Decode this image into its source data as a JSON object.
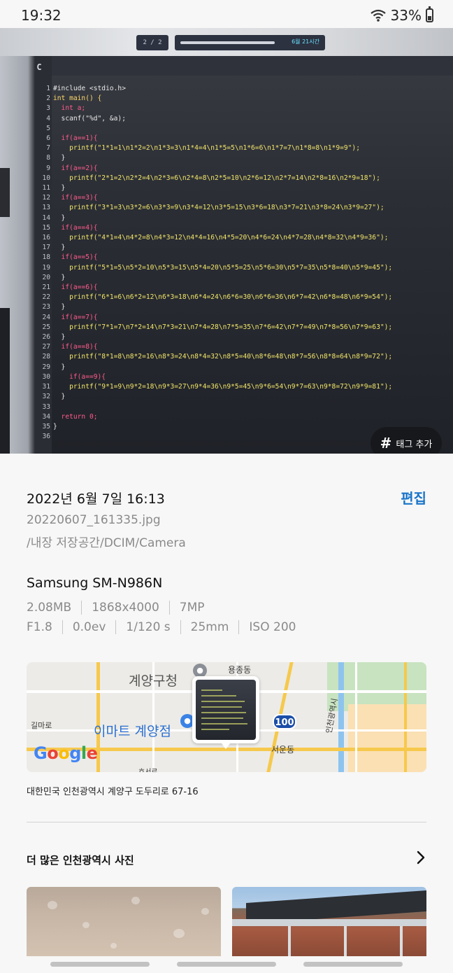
{
  "status_bar": {
    "time": "19:32",
    "battery": "33%"
  },
  "photo": {
    "counter": "2 / 2",
    "progress_label": "6월 21시간",
    "editor_tab": "C",
    "code_lines": [
      [
        "#include <stdio.h>",
        "plain"
      ],
      [
        "int main() {",
        "fn"
      ],
      [
        "  int a;",
        "kw"
      ],
      [
        "  scanf(\"%d\", &a);",
        "plain"
      ],
      [
        "",
        "plain"
      ],
      [
        "  if(a==1){",
        "kw"
      ],
      [
        "    printf(\"1*1=1\\n1*2=2\\n1*3=3\\n1*4=4\\n1*5=5\\n1*6=6\\n1*7=7\\n1*8=8\\n1*9=9\");",
        "str"
      ],
      [
        "  }",
        "plain"
      ],
      [
        "  if(a==2){",
        "kw"
      ],
      [
        "    printf(\"2*1=2\\n2*2=4\\n2*3=6\\n2*4=8\\n2*5=10\\n2*6=12\\n2*7=14\\n2*8=16\\n2*9=18\");",
        "str"
      ],
      [
        "  }",
        "plain"
      ],
      [
        "  if(a==3){",
        "kw"
      ],
      [
        "    printf(\"3*1=3\\n3*2=6\\n3*3=9\\n3*4=12\\n3*5=15\\n3*6=18\\n3*7=21\\n3*8=24\\n3*9=27\");",
        "str"
      ],
      [
        "  }",
        "plain"
      ],
      [
        "  if(a==4){",
        "kw"
      ],
      [
        "    printf(\"4*1=4\\n4*2=8\\n4*3=12\\n4*4=16\\n4*5=20\\n4*6=24\\n4*7=28\\n4*8=32\\n4*9=36\");",
        "str"
      ],
      [
        "  }",
        "plain"
      ],
      [
        "  if(a==5){",
        "kw"
      ],
      [
        "    printf(\"5*1=5\\n5*2=10\\n5*3=15\\n5*4=20\\n5*5=25\\n5*6=30\\n5*7=35\\n5*8=40\\n5*9=45\");",
        "str"
      ],
      [
        "  }",
        "plain"
      ],
      [
        "  if(a==6){",
        "kw"
      ],
      [
        "    printf(\"6*1=6\\n6*2=12\\n6*3=18\\n6*4=24\\n6*6=30\\n6*6=36\\n6*7=42\\n6*8=48\\n6*9=54\");",
        "str"
      ],
      [
        "  }",
        "plain"
      ],
      [
        "  if(a==7){",
        "kw"
      ],
      [
        "    printf(\"7*1=7\\n7*2=14\\n7*3=21\\n7*4=28\\n7*5=35\\n7*6=42\\n7*7=49\\n7*8=56\\n7*9=63\");",
        "str"
      ],
      [
        "  }",
        "plain"
      ],
      [
        "  if(a==8){",
        "kw"
      ],
      [
        "    printf(\"8*1=8\\n8*2=16\\n8*3=24\\n8*4=32\\n8*5=40\\n8*6=48\\n8*7=56\\n8*8=64\\n8*9=72\");",
        "str"
      ],
      [
        "  }",
        "plain"
      ],
      [
        "    if(a==9){",
        "kw"
      ],
      [
        "    printf(\"9*1=9\\n9*2=18\\n9*3=27\\n9*4=36\\n9*5=45\\n9*6=54\\n9*7=63\\n9*8=72\\n9*9=81\");",
        "str"
      ],
      [
        "  }",
        "plain"
      ],
      [
        "",
        "plain"
      ],
      [
        "  return 0;",
        "kw"
      ],
      [
        "}",
        "plain"
      ],
      [
        "",
        "plain"
      ]
    ],
    "tag_button": "태그 추가"
  },
  "details": {
    "date": "2022년 6월 7일 16:13",
    "edit": "편집",
    "filename": "20220607_161335.jpg",
    "path": "/내장 저장공간/DCIM/Camera",
    "device": "Samsung SM-N986N",
    "meta_row1": [
      "2.08MB",
      "1868x4000",
      "7MP"
    ],
    "meta_row2": [
      "F1.8",
      "0.0ev",
      "1/120 s",
      "25mm",
      "ISO 200"
    ]
  },
  "map": {
    "labels": {
      "gyeyang_office": "계양구청",
      "yongjong": "용종동",
      "gilmaro": "길마로",
      "emart": "이마트 계양점",
      "seoun": "서운동",
      "route": "100",
      "incheon_line": "인천광역시",
      "bottom": "효서로"
    },
    "google": [
      "G",
      "o",
      "o",
      "g",
      "l",
      "e"
    ]
  },
  "address": "대한민국 인천광역시 계양구 도두리로 67-16",
  "more": {
    "title": "더 많은 인천광역시 사진"
  },
  "colors": {
    "accent": "#1a75c9",
    "tag_bg": "#17181b"
  }
}
